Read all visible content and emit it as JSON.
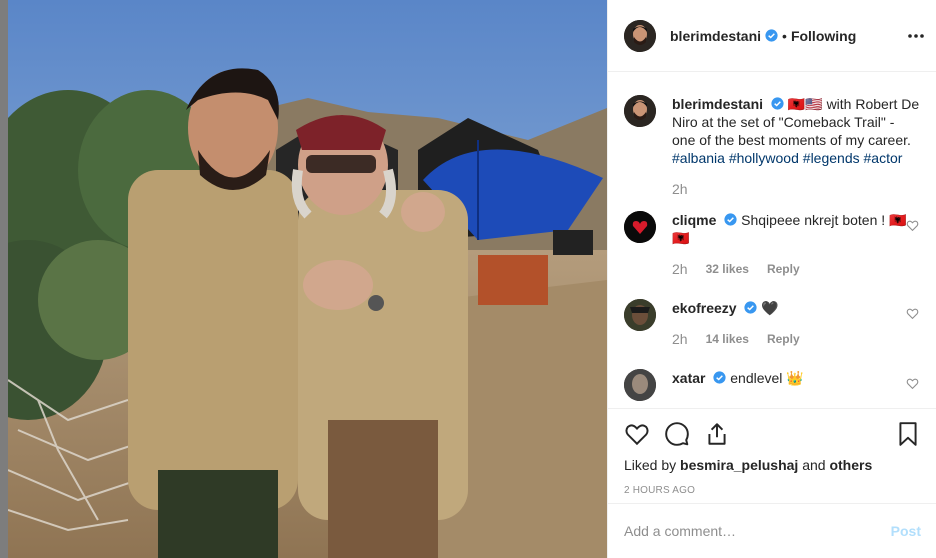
{
  "header": {
    "username": "blerimdestani",
    "separator": "•",
    "follow_status": "Following",
    "more_icon": "more-horizontal-icon"
  },
  "caption": {
    "username": "blerimdestani",
    "text": "🇦🇱🇺🇸 with Robert De Niro at the set of \"Comeback Trail\" - one of the best moments of my career.",
    "hashtags": [
      "#albania",
      "#hollywood",
      "#legends",
      "#actor"
    ],
    "time": "2h"
  },
  "comments": [
    {
      "username": "cliqme",
      "verified": true,
      "text": "Shqipeee nkrejt boten ! 🇦🇱🇦🇱",
      "time": "2h",
      "likes": "32 likes",
      "reply": "Reply"
    },
    {
      "username": "ekofreezy",
      "verified": true,
      "text": "🖤",
      "time": "2h",
      "likes": "14 likes",
      "reply": "Reply"
    },
    {
      "username": "xatar",
      "verified": true,
      "text": "endlevel 👑"
    }
  ],
  "likes": {
    "prefix": "Liked by",
    "user": "besmira_pelushaj",
    "and": "and",
    "others": "others"
  },
  "timestamp": "2 HOURS AGO",
  "add_comment": {
    "placeholder": "Add a comment…",
    "post_label": "Post"
  },
  "colors": {
    "verified": "#3897f0",
    "hashtag": "#00376b",
    "muted": "#8e8e8e",
    "post_disabled": "#b2dffc"
  }
}
